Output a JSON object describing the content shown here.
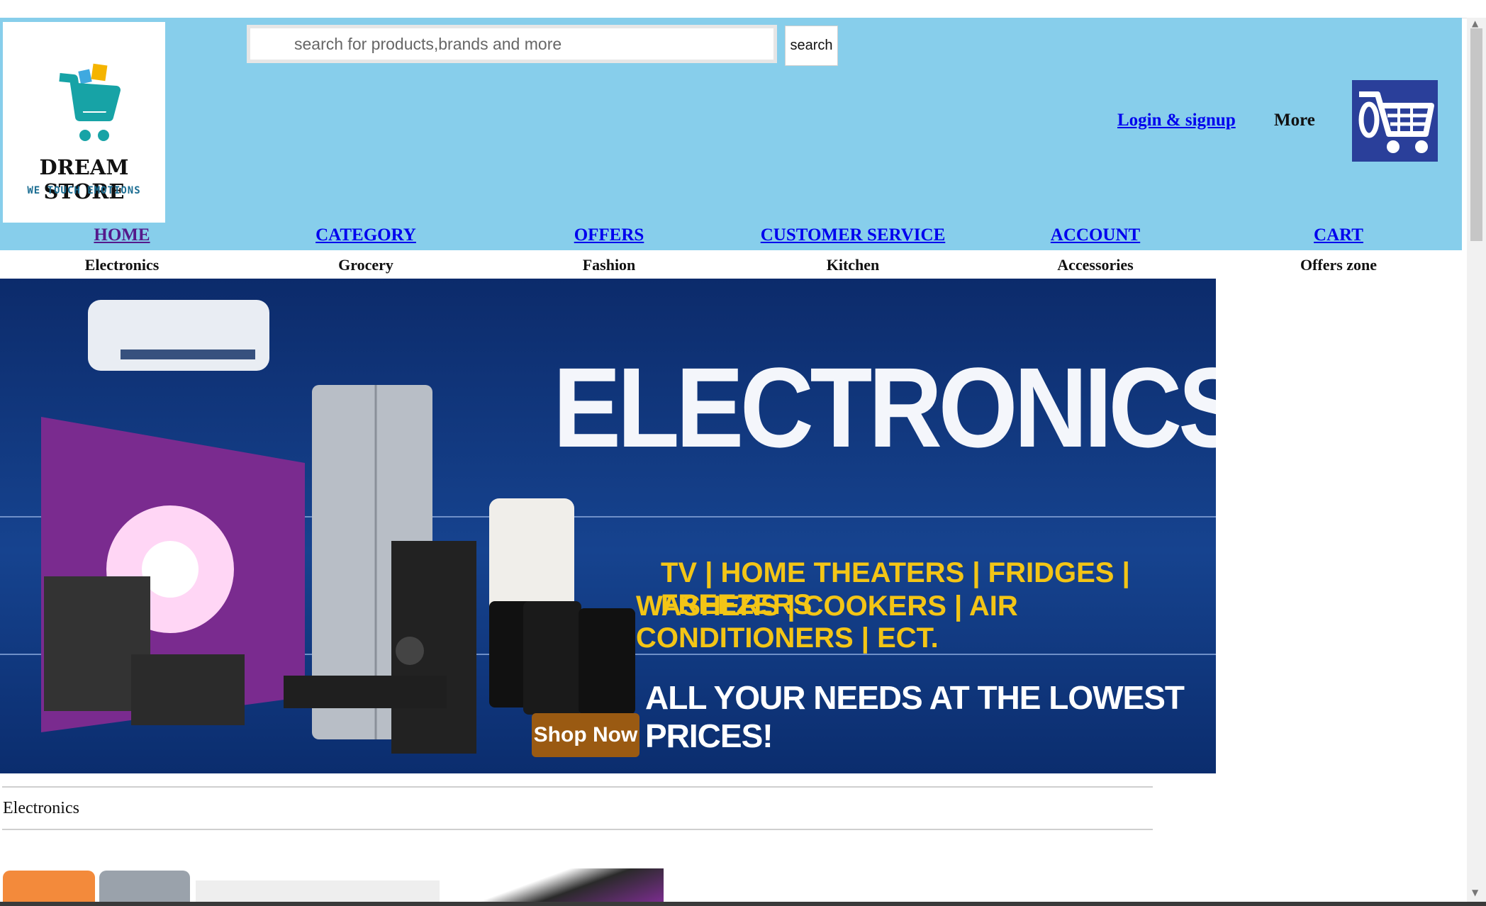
{
  "logo": {
    "title": "DREAM STORE",
    "tagline": "WE TOUCH EMOTIONS"
  },
  "search": {
    "placeholder": "search for products,brands and more",
    "button_label": "search"
  },
  "header_links": {
    "login": "Login & signup",
    "more": "More"
  },
  "nav": [
    {
      "label": "HOME",
      "visited": true
    },
    {
      "label": "CATEGORY",
      "visited": false
    },
    {
      "label": "OFFERS",
      "visited": false
    },
    {
      "label": "CUSTOMER SERVICE",
      "visited": false
    },
    {
      "label": "ACCOUNT",
      "visited": false
    },
    {
      "label": "CART",
      "visited": false
    }
  ],
  "subnav": [
    "Electronics",
    "Grocery",
    "Fashion",
    "Kitchen",
    "Accessories",
    "Offers zone"
  ],
  "banner": {
    "title": "ELECTRONICS",
    "categories_line1": "TV | HOME THEATERS | FRIDGES | FREEZERS",
    "categories_line2": "WASHERS | COOKERS | AIR CONDITIONERS | ECT.",
    "tagline": "ALL YOUR NEEDS AT THE LOWEST PRICES!",
    "button": "Shop Now"
  },
  "section": {
    "title": "Electronics"
  },
  "icons": {
    "cart": "cart-icon",
    "logo": "shopping-cart-logo-icon"
  },
  "colors": {
    "header_bg": "#87ceeb",
    "link": "#0000ee",
    "visited": "#551a8b",
    "banner_bg": "#16438f",
    "banner_accent": "#f3c516"
  }
}
